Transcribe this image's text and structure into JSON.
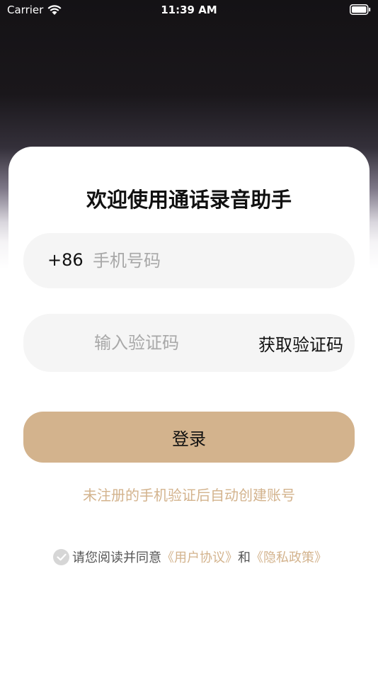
{
  "status_bar": {
    "carrier": "Carrier",
    "time": "11:39 AM"
  },
  "login": {
    "title": "欢迎使用通话录音助手",
    "country_code": "+86",
    "phone_placeholder": "手机号码",
    "code_placeholder": "输入验证码",
    "get_code_label": "获取验证码",
    "login_label": "登录",
    "register_hint": "未注册的手机验证后自动创建账号"
  },
  "agreement": {
    "prefix": "请您阅读并同意",
    "user_agreement": "《用户协议》",
    "and": "和",
    "privacy_policy": "《隐私政策》",
    "checked": true
  },
  "colors": {
    "accent": "#d3b38d",
    "input_bg": "#f5f5f5"
  },
  "icons": [
    "wifi-icon",
    "battery-icon",
    "checkmark-icon"
  ]
}
